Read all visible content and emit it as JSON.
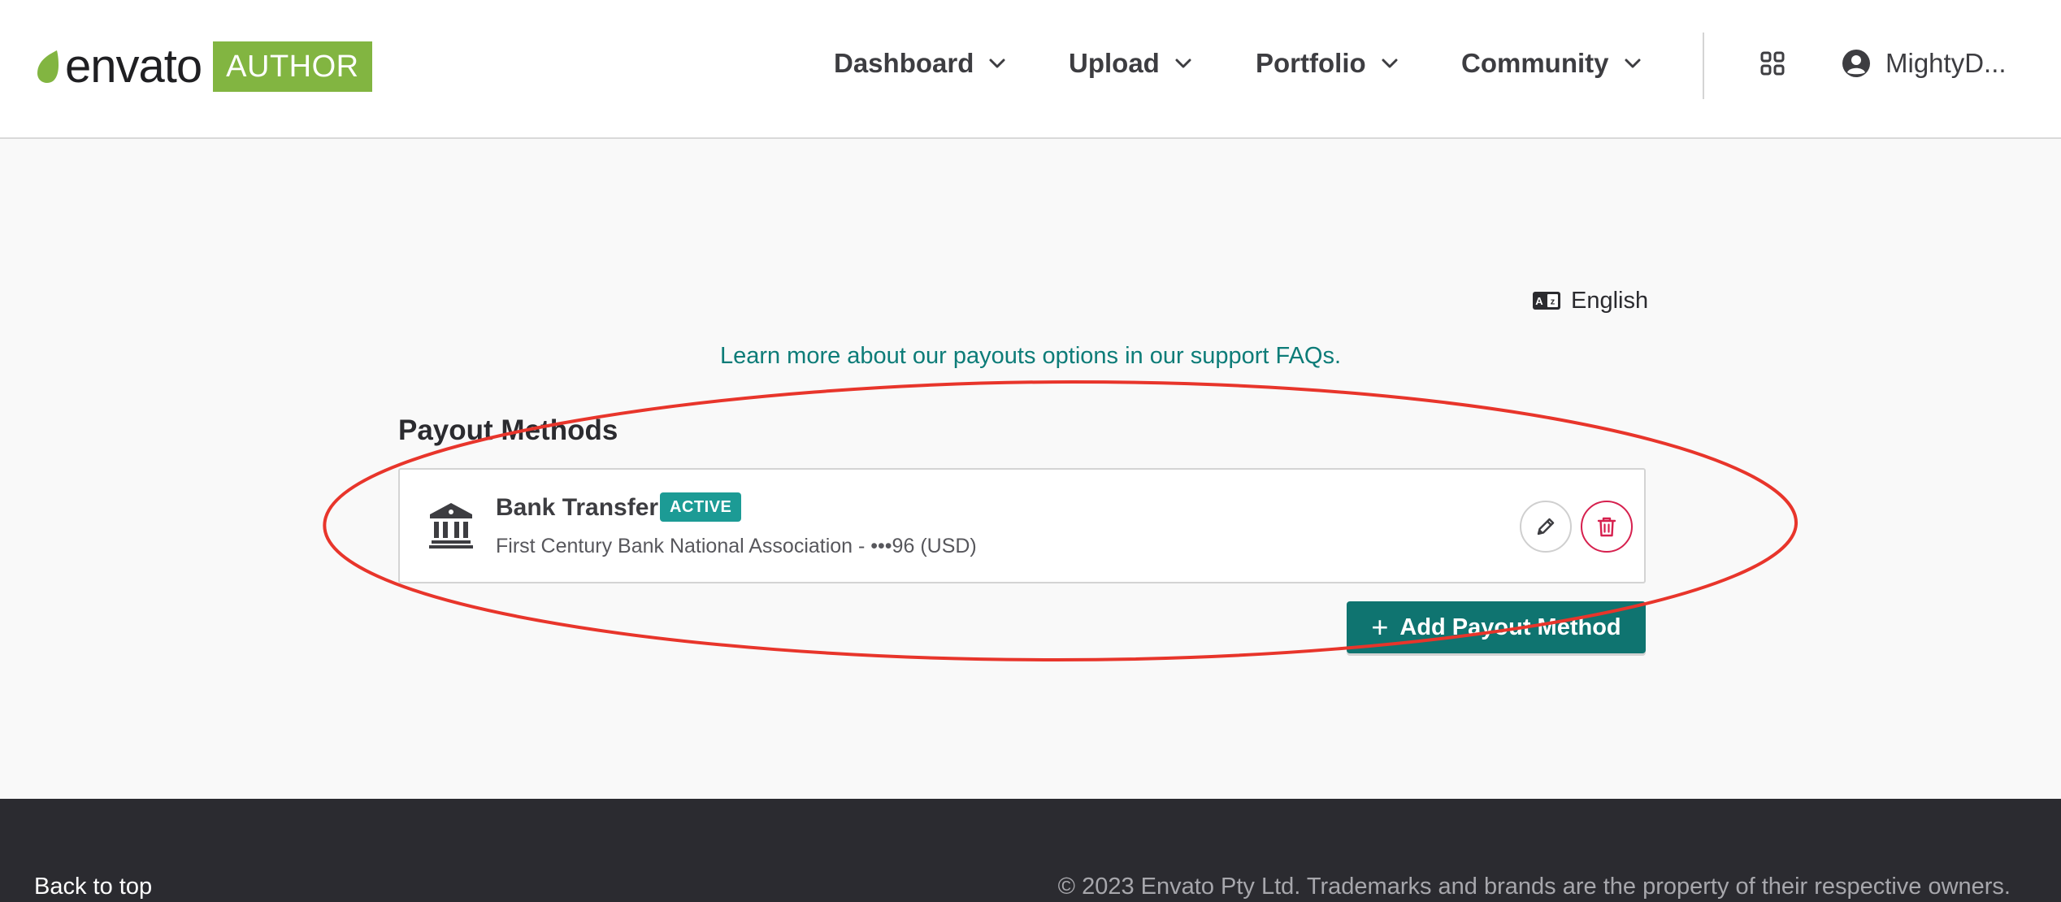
{
  "header": {
    "logo_word": "envato",
    "logo_badge": "AUTHOR",
    "nav": [
      {
        "label": "Dashboard"
      },
      {
        "label": "Upload"
      },
      {
        "label": "Portfolio"
      },
      {
        "label": "Community"
      }
    ],
    "user_name": "MightyD..."
  },
  "main": {
    "language": "English",
    "faq_link": "Learn more about our payouts options in our support FAQs.",
    "section_title": "Payout Methods",
    "payout_methods": [
      {
        "title": "Bank Transfer",
        "status": "ACTIVE",
        "description": "First Century Bank National Association - •••96 (USD)"
      }
    ],
    "add_button": "Add Payout Method"
  },
  "footer": {
    "back_to_top": "Back to top",
    "copyright": "© 2023 Envato Pty Ltd. Trademarks and brands are the property of their respective owners."
  },
  "colors": {
    "brand_green": "#82b541",
    "teal": "#0f7470",
    "badge_teal": "#1c9b95",
    "delete_red": "#d6204e",
    "annotation_red": "#e8352b",
    "footer_bg": "#2b2b30"
  },
  "icons": {
    "nav_chevron": "chevron-down-icon",
    "apps": "grid-icon",
    "user": "user-circle-icon",
    "language": "translate-icon",
    "bank": "bank-icon",
    "edit": "pencil-icon",
    "delete": "trash-icon"
  }
}
